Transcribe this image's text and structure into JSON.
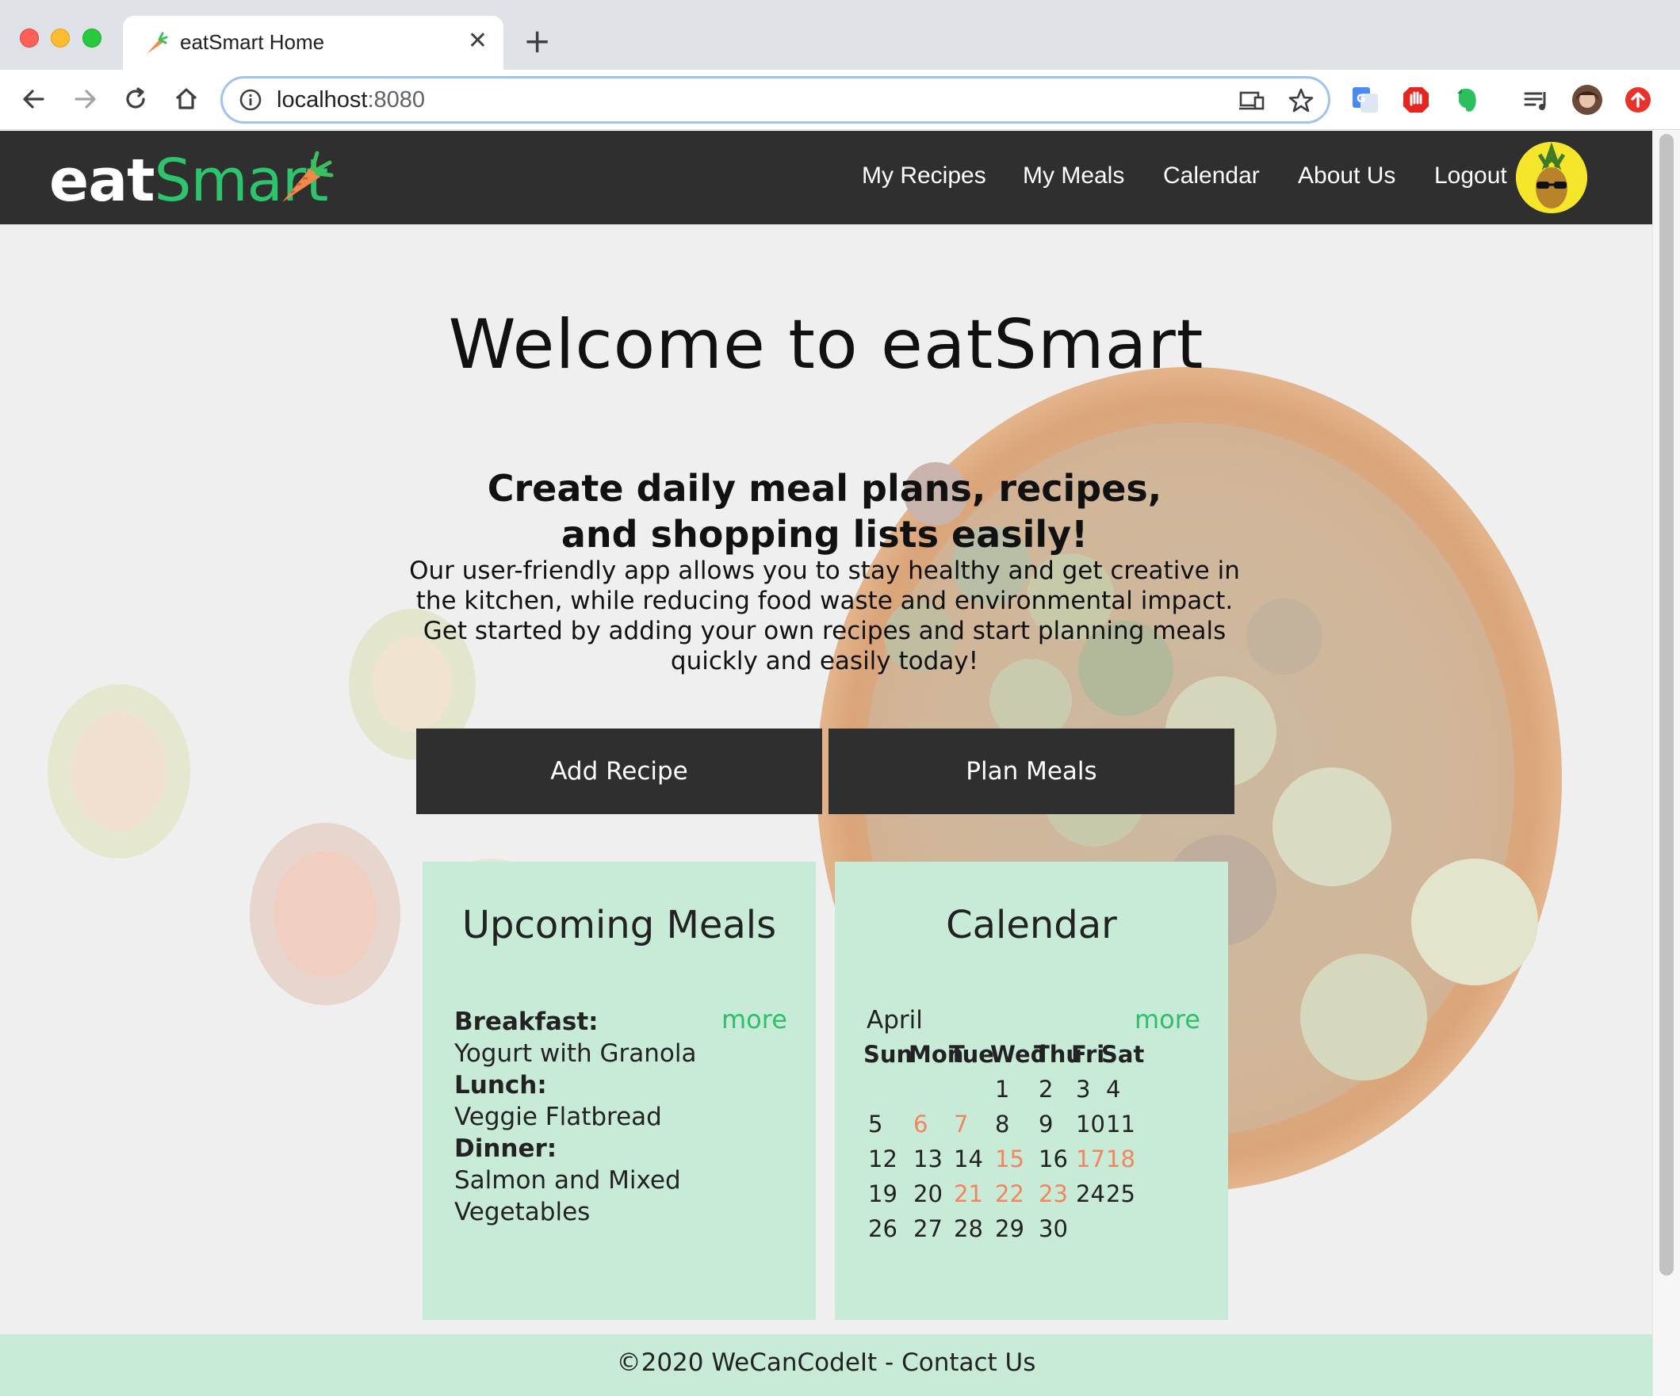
{
  "browser": {
    "tab_title": "eatSmart Home",
    "url_host": "localhost",
    "url_port": ":8080"
  },
  "nav": {
    "logo_eat": "eat",
    "logo_smart": "Smart",
    "links": [
      "My Recipes",
      "My Meals",
      "Calendar",
      "About Us",
      "Logout"
    ]
  },
  "hero": {
    "title": "Welcome to eatSmart",
    "subtitle": "Create daily meal plans, recipes, and shopping lists easily!",
    "blurb": "Our user-friendly app allows you to stay healthy and get creative in the kitchen, while reducing food waste and environmental impact. Get started by adding your own recipes and start planning meals quickly and easily today!"
  },
  "buttons": {
    "add_recipe": "Add Recipe",
    "plan_meals": "Plan Meals"
  },
  "upcoming": {
    "title": "Upcoming Meals",
    "more": "more",
    "breakfast_label": "Breakfast:",
    "breakfast": "Yogurt with Granola",
    "lunch_label": "Lunch:",
    "lunch": "Veggie Flatbread",
    "dinner_label": "Dinner:",
    "dinner_line1": "Salmon and Mixed",
    "dinner_line2": "Vegetables"
  },
  "calendar": {
    "title": "Calendar",
    "month": "April",
    "more": "more",
    "weekdays": [
      "Sun",
      "Mon",
      "Tue",
      "Wed",
      "Thu",
      "Fri",
      "Sat"
    ],
    "weeks": [
      [
        "",
        "",
        "",
        "1",
        "2",
        "3",
        "4"
      ],
      [
        "5",
        "6",
        "7",
        "8",
        "9",
        "10",
        "11"
      ],
      [
        "12",
        "13",
        "14",
        "15",
        "16",
        "17",
        "18"
      ],
      [
        "19",
        "20",
        "21",
        "22",
        "23",
        "24",
        "25"
      ],
      [
        "26",
        "27",
        "28",
        "29",
        "30",
        "",
        ""
      ]
    ],
    "highlighted_days": [
      "6",
      "7",
      "15",
      "17",
      "18",
      "21",
      "22",
      "23"
    ],
    "highlight_color": "#f4845f"
  },
  "footer": {
    "text": "©2020 WeCanCodeIt - Contact Us"
  },
  "colors": {
    "nav_bg": "#2f2f2f",
    "brand_green": "#2ec46e",
    "card_bg": "#c8ebd8",
    "button_bg": "#2f2f2f"
  }
}
